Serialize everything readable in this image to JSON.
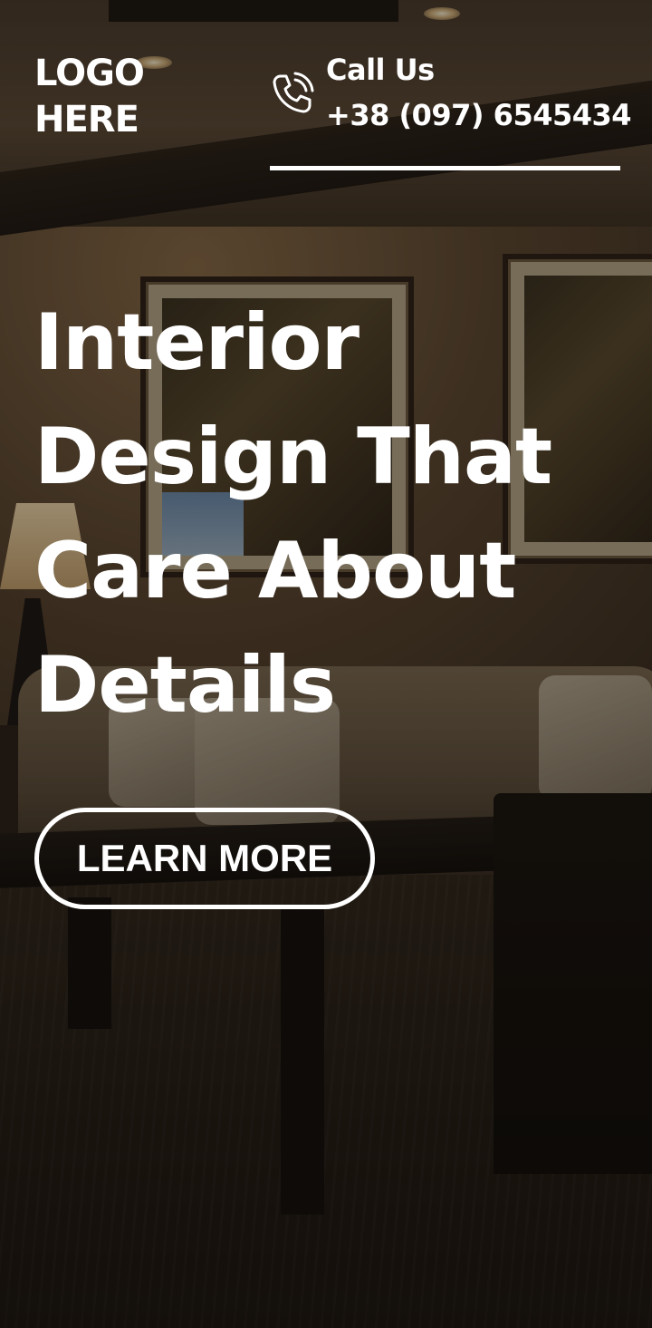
{
  "header": {
    "logo_text": "LOGO HERE",
    "contact": {
      "icon": "phone-icon",
      "label": "Call Us",
      "number": "+38 (097) 6545434"
    }
  },
  "hero": {
    "title": "Interior Design That Care About Details",
    "cta_label": "LEARN MORE"
  },
  "colors": {
    "text": "#ffffff",
    "overlay": "rgba(10,7,4,0.38)"
  }
}
